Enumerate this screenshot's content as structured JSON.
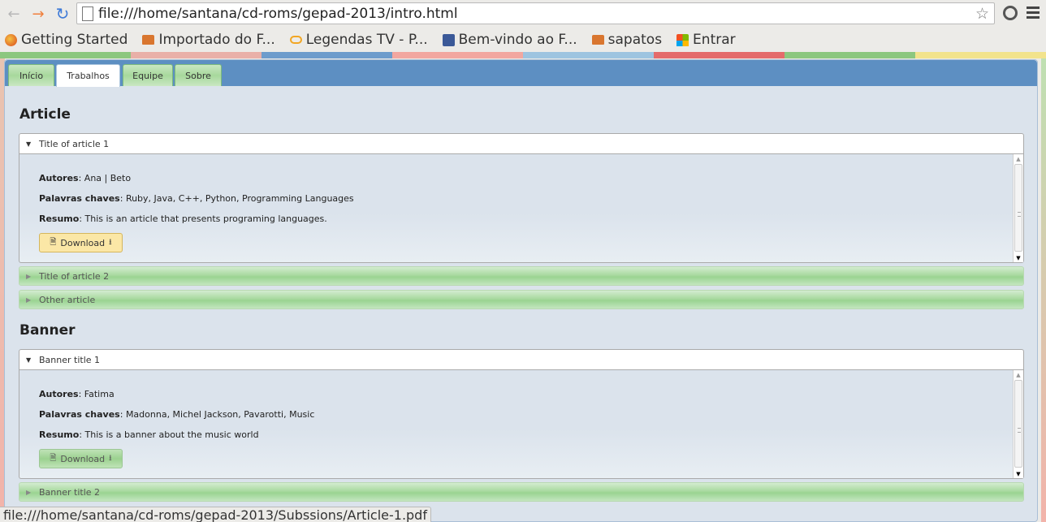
{
  "browser": {
    "url": "file:///home/santana/cd-roms/gepad-2013/intro.html",
    "bookmarks": [
      {
        "label": "Getting Started",
        "icon": "firefox-icon"
      },
      {
        "label": "Importado do F...",
        "icon": "folder-icon"
      },
      {
        "label": "Legendas TV - P...",
        "icon": "cloud-icon"
      },
      {
        "label": "Bem-vindo ao F...",
        "icon": "facebook-icon"
      },
      {
        "label": "sapatos",
        "icon": "folder-icon"
      },
      {
        "label": "Entrar",
        "icon": "microsoft-icon"
      }
    ],
    "status_url": "file:///home/santana/cd-roms/gepad-2013/Subssions/Article-1.pdf"
  },
  "tabs": [
    "Início",
    "Trabalhos",
    "Equipe",
    "Sobre"
  ],
  "active_tab": "Trabalhos",
  "labels": {
    "authors": "Autores",
    "keywords": "Palavras chaves",
    "summary": "Resumo",
    "download": "Download"
  },
  "sections": [
    {
      "title": "Article",
      "items": [
        {
          "title": "Title of article 1",
          "authors": "Ana | Beto",
          "keywords": "Ruby, Java, C++, Python, Programming Languages",
          "summary": "This is an article that presents programing languages."
        },
        {
          "title": "Title of article 2"
        },
        {
          "title": "Other article"
        }
      ]
    },
    {
      "title": "Banner",
      "items": [
        {
          "title": "Banner title 1",
          "authors": "Fatima",
          "keywords": "Madonna, Michel Jackson, Pavarotti, Music",
          "summary": "This is a banner about the music world"
        },
        {
          "title": "Banner title 2"
        }
      ]
    }
  ],
  "colors": {
    "tabbar": "#5d8fc2",
    "content_bg": "#dbe3ec",
    "accordion_closed": "#a9d9a0",
    "download_hover": "#fbe7a6"
  }
}
